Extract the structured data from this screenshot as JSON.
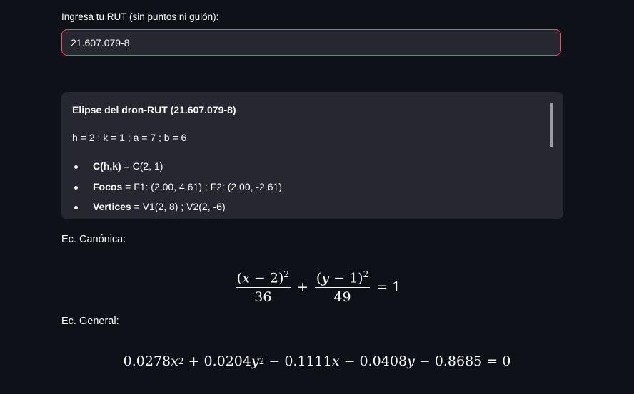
{
  "rut_input": {
    "label": "Ingresa tu RUT (sin puntos ni guión):",
    "value": "21.607.079-8"
  },
  "info_box": {
    "title": "Elipse del dron-RUT (21.607.079-8)",
    "params": "h = 2 ; k = 1 ; a = 7 ; b = 6",
    "items": [
      {
        "term": "C(h,k)",
        "text": " = C(2, 1)"
      },
      {
        "term": "Focos",
        "text": " = F1: (2.00, 4.61) ; F2: (2.00, -2.61)"
      },
      {
        "term": "Vertices",
        "text": " = V1(2, 8) ; V2(2, -6)"
      }
    ]
  },
  "canonical": {
    "label": "Ec. Canónica:",
    "num1_open": "(",
    "num1_var": "x",
    "num1_rest": " − 2)",
    "num1_exp": "2",
    "den1": "36",
    "plus": "+",
    "num2_open": "(",
    "num2_var": "y",
    "num2_rest": " − 1)",
    "num2_exp": "2",
    "den2": "49",
    "equals": "= 1"
  },
  "general": {
    "label": "Ec. General:",
    "c1": "0.0278",
    "v1": "x",
    "e1": "2",
    "c2": " + 0.0204",
    "v2": "y",
    "e2": "2",
    "c3": " − 0.1111",
    "v3": "x",
    "c4": " − 0.0408",
    "v4": "y",
    "c5": " − 0.8685 = 0"
  }
}
